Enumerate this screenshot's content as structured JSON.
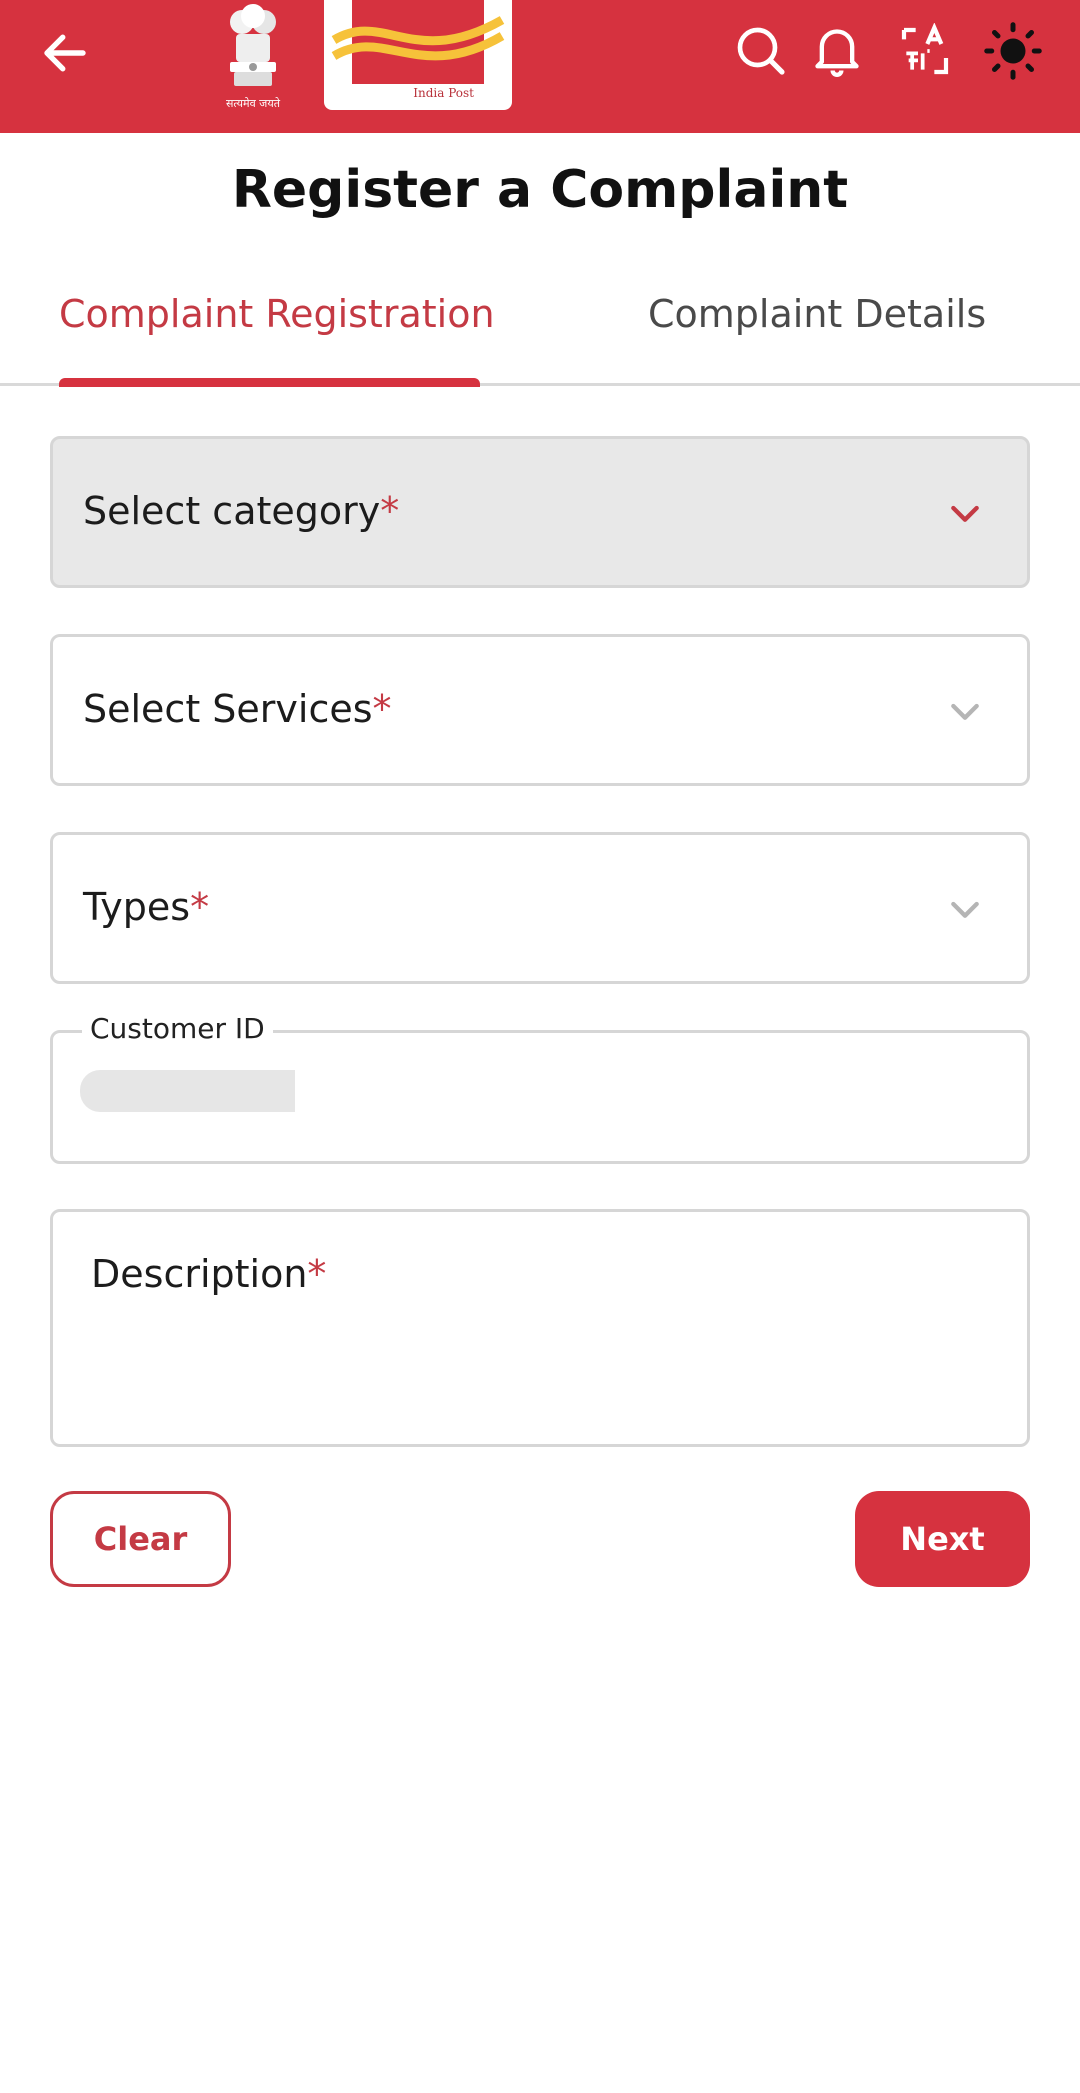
{
  "header": {
    "emblem_caption": "सत्यमेव जयते",
    "logo_caption": "India Post"
  },
  "page": {
    "title": "Register a Complaint"
  },
  "tabs": [
    {
      "label": "Complaint Registration",
      "active": true
    },
    {
      "label": "Complaint Details",
      "active": false
    }
  ],
  "form": {
    "category": {
      "label": "Select category",
      "required": "*"
    },
    "services": {
      "label": "Select Services",
      "required": "*"
    },
    "types": {
      "label": "Types",
      "required": "*"
    },
    "customer_id": {
      "label": "Customer ID"
    },
    "description": {
      "label": "Description",
      "required": "*"
    }
  },
  "actions": {
    "clear": "Clear",
    "next": "Next"
  },
  "colors": {
    "brand": "#d6323f",
    "accent_text": "#c43a44"
  }
}
